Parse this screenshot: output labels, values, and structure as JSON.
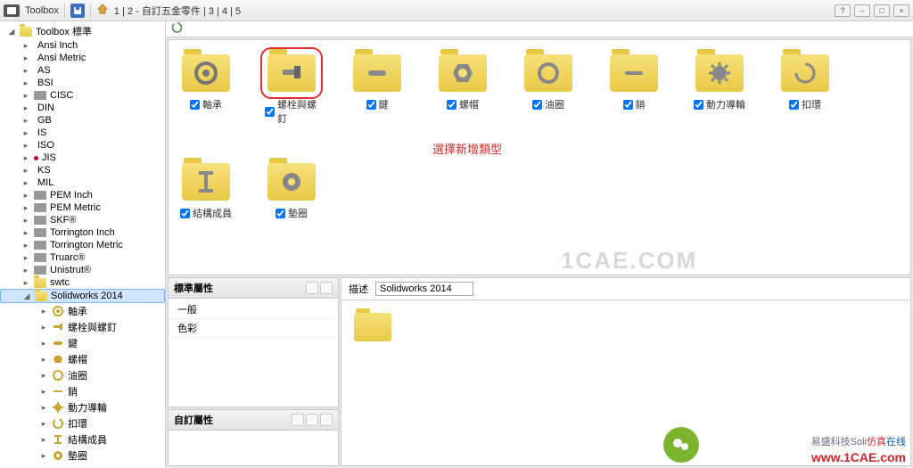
{
  "toolbar": {
    "app_name": "Toolbox",
    "breadcrumb": "1 | 2 - 自訂五金零件 | 3 | 4 | 5"
  },
  "tree": {
    "root": "Toolbox 標準",
    "standards": [
      {
        "label": "Ansi Inch",
        "flag": "flag-us"
      },
      {
        "label": "Ansi Metric",
        "flag": "flag-us"
      },
      {
        "label": "AS",
        "flag": "flag-au"
      },
      {
        "label": "BSI",
        "flag": "flag-uk"
      },
      {
        "label": "CISC",
        "flag": "gen-icon"
      },
      {
        "label": "DIN",
        "flag": "flag-de"
      },
      {
        "label": "GB",
        "flag": "flag-cn"
      },
      {
        "label": "IS",
        "flag": "flag-in"
      },
      {
        "label": "ISO",
        "flag": "flag-iso"
      },
      {
        "label": "JIS",
        "flag": "flag-jp"
      },
      {
        "label": "KS",
        "flag": "flag-kr"
      },
      {
        "label": "MIL",
        "flag": "flag-us"
      },
      {
        "label": "PEM Inch",
        "flag": "gen-icon"
      },
      {
        "label": "PEM Metric",
        "flag": "gen-icon"
      },
      {
        "label": "SKF®",
        "flag": "gen-icon"
      },
      {
        "label": "Torrington Inch",
        "flag": "gen-icon"
      },
      {
        "label": "Torrington Metric",
        "flag": "gen-icon"
      },
      {
        "label": "Truarc®",
        "flag": "gen-icon"
      },
      {
        "label": "Unistrut®",
        "flag": "gen-icon"
      },
      {
        "label": "swtc",
        "flag": "folder-icon"
      }
    ],
    "custom": {
      "label": "Solidworks 2014",
      "children": [
        {
          "label": "軸承"
        },
        {
          "label": "螺栓與螺釘"
        },
        {
          "label": "鍵"
        },
        {
          "label": "螺帽"
        },
        {
          "label": "油圈"
        },
        {
          "label": "銷"
        },
        {
          "label": "動力導輪"
        },
        {
          "label": "扣環"
        },
        {
          "label": "結構成員"
        },
        {
          "label": "墊圈"
        }
      ]
    }
  },
  "grid": {
    "items": [
      {
        "label": "軸承",
        "icon": "bearing"
      },
      {
        "label": "螺栓與螺釘",
        "icon": "bolt",
        "selected": true
      },
      {
        "label": "鍵",
        "icon": "key"
      },
      {
        "label": "螺帽",
        "icon": "nut"
      },
      {
        "label": "油圈",
        "icon": "oring"
      },
      {
        "label": "銷",
        "icon": "pin"
      },
      {
        "label": "動力導輪",
        "icon": "gear"
      },
      {
        "label": "扣環",
        "icon": "retring"
      },
      {
        "label": "結構成員",
        "icon": "ibeam"
      },
      {
        "label": "墊圈",
        "icon": "washer"
      }
    ],
    "annotation": "選擇新增類型"
  },
  "std_pane": {
    "title": "標準屬性",
    "rows": [
      "一般",
      "色彩"
    ]
  },
  "custom_pane": {
    "title": "自訂屬性"
  },
  "desc": {
    "label": "描述",
    "value": "Solidworks 2014"
  },
  "watermark": "1CAE.COM",
  "brand": {
    "text1": "易盛科技Soli",
    "sim1": "仿真",
    "sim2": "在线",
    "url": "www.1CAE.com"
  }
}
